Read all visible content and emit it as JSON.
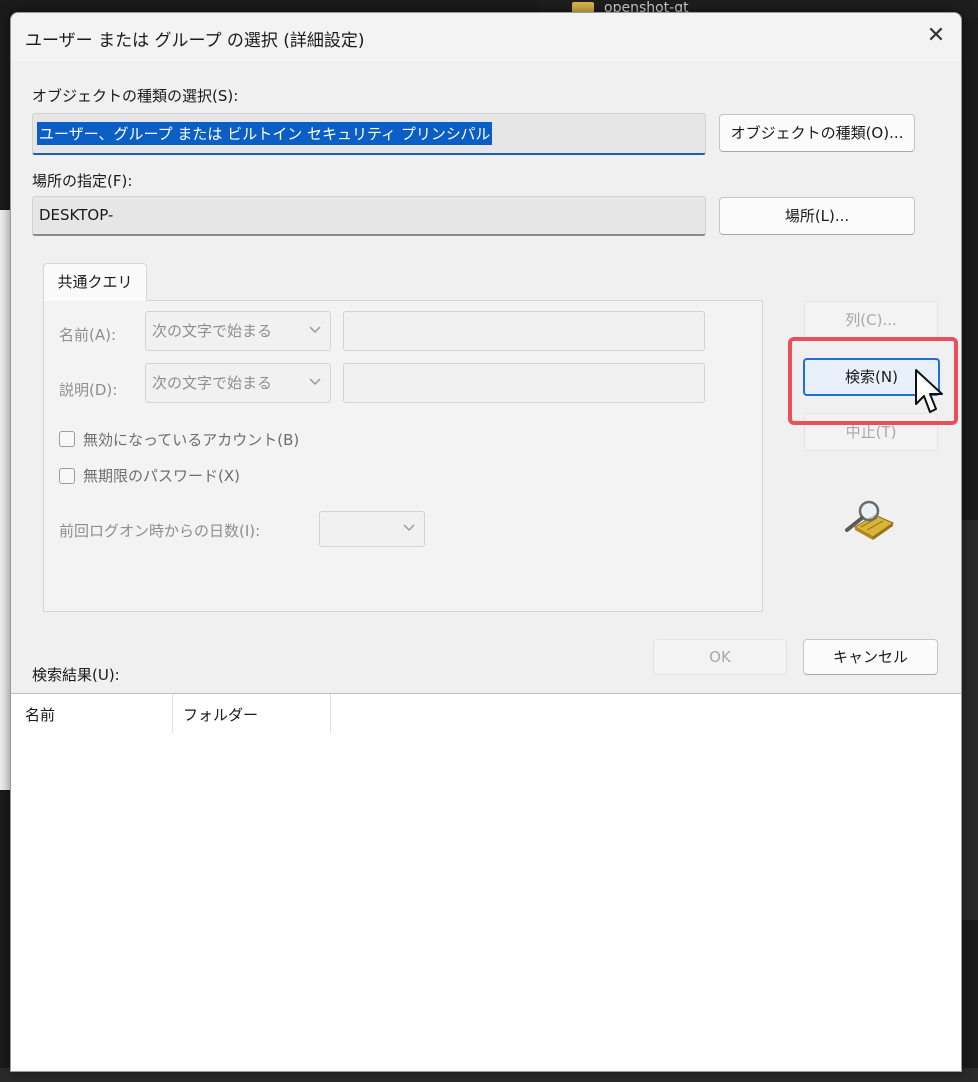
{
  "background": {
    "folder_text": "openshot-qt"
  },
  "dialog": {
    "title": "ユーザー または グループ の選択 (詳細設定)",
    "close_symbol": "✕"
  },
  "object_type": {
    "label": "オブジェクトの種類の選択(S):",
    "value": "ユーザー、グループ または ビルトイン セキュリティ プリンシパル",
    "button": "オブジェクトの種類(O)..."
  },
  "location": {
    "label": "場所の指定(F):",
    "value": "DESKTOP-",
    "button": "場所(L)..."
  },
  "query": {
    "tab_label": "共通クエリ",
    "name_label": "名前(A):",
    "name_mode": "次の文字で始まる",
    "description_label": "説明(D):",
    "description_mode": "次の文字で始まる",
    "disabled_accounts_label": "無効になっているアカウント(B)",
    "no_expire_password_label": "無期限のパスワード(X)",
    "days_since_logon_label": "前回ログオン時からの日数(I):",
    "days_since_logon_value": ""
  },
  "buttons": {
    "columns": "列(C)...",
    "search": "検索(N)",
    "stop": "中止(T)",
    "ok": "OK",
    "cancel": "キャンセル"
  },
  "results": {
    "label": "検索結果(U):",
    "columns": [
      "名前",
      "フォルダー"
    ]
  },
  "colors": {
    "highlight": "#e8505b",
    "selection": "#0b5fc4",
    "focus": "#1f6fd6"
  },
  "icons": {
    "search_icon": "magnifier-over-directory-icon",
    "cursor": "mouse-pointer-icon"
  }
}
